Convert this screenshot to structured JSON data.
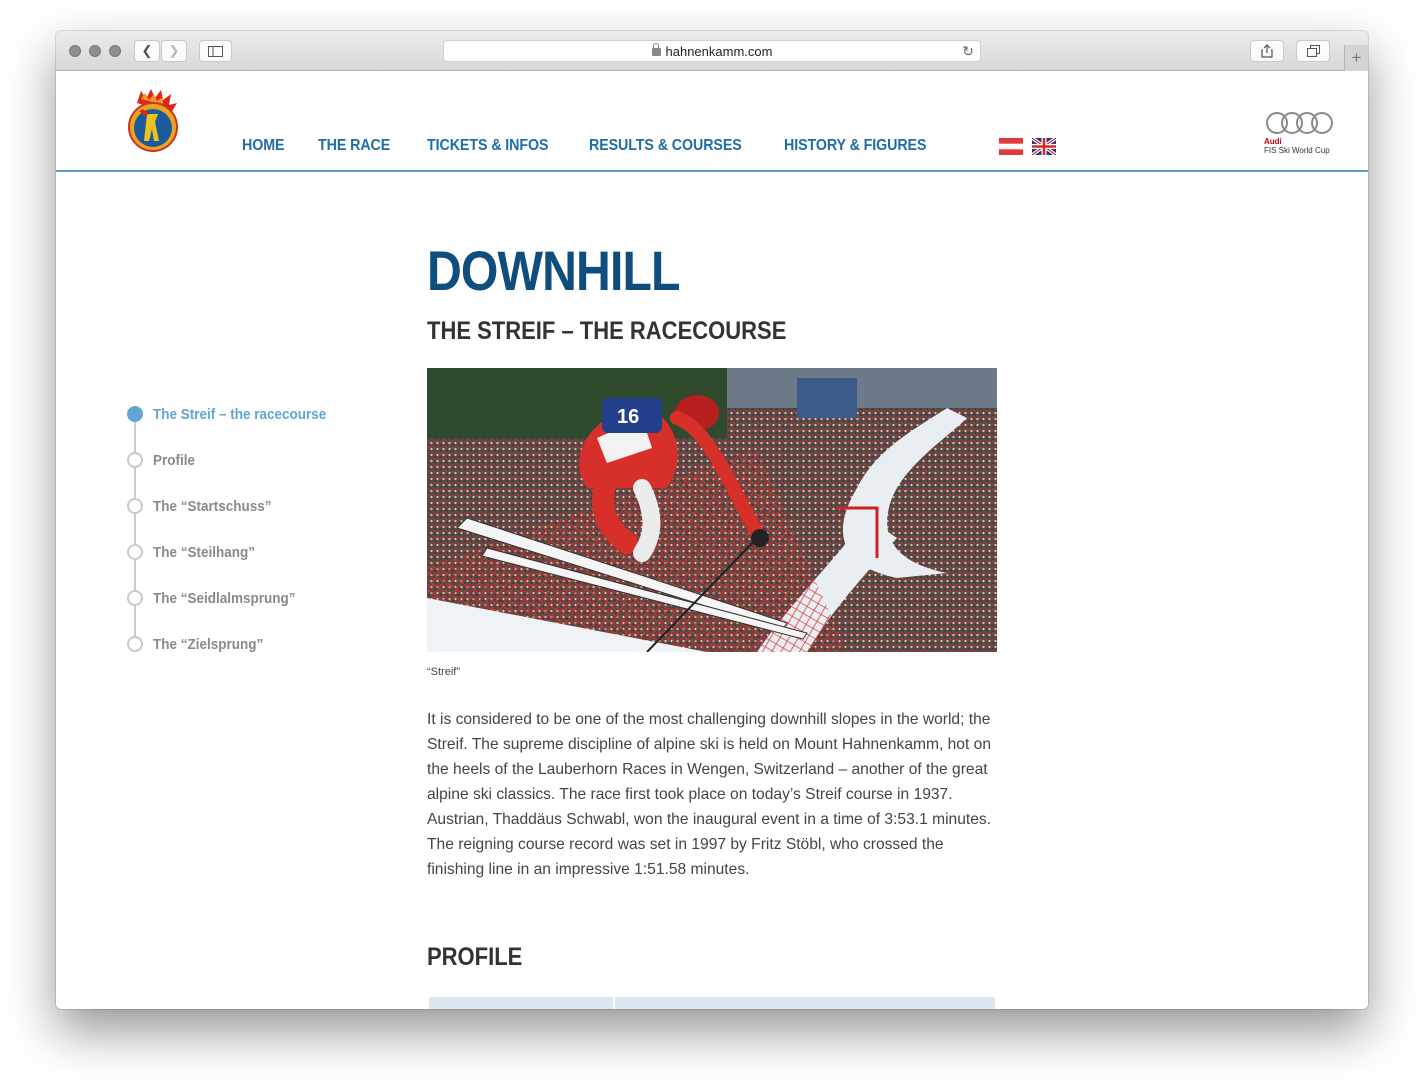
{
  "browser": {
    "url": "hahnenkamm.com"
  },
  "header": {
    "nav": [
      "HOME",
      "THE RACE",
      "TICKETS & INFOS",
      "RESULTS & COURSES",
      "HISTORY & FIGURES"
    ],
    "sponsor": {
      "line1": "Audi",
      "line2": "FIS Ski World Cup"
    }
  },
  "sidebar": {
    "items": [
      {
        "label": "The Streif – the racecourse",
        "active": true
      },
      {
        "label": "Profile",
        "active": false
      },
      {
        "label": "The “Startschuss”",
        "active": false
      },
      {
        "label": "The “Steilhang”",
        "active": false
      },
      {
        "label": "The “Seidlalmsprung”",
        "active": false
      },
      {
        "label": "The “Zielsprung”",
        "active": false
      }
    ]
  },
  "main": {
    "title": "DOWNHILL",
    "section_title": "THE STREIF – THE RACECOURSE",
    "image_caption": "“Streif”",
    "paragraph": "It is considered to be one of the most challenging downhill slopes in the world; the Streif. The supreme discipline of alpine ski is held on Mount Hahnenkamm, hot on the heels of the Lauberhorn Races in Wengen, Switzerland – another of the great alpine ski classics. The race first took place on today’s Streif course in 1937. Austrian, Thaddäus Schwabl, won the inaugural event in a time of 3:53.1 minutes. The reigning course record was set in 1997 by Fritz Stöbl, who crossed the finishing line in an impressive 1:51.58 minutes.",
    "profile_title": "PROFILE",
    "bib_number": "16"
  },
  "colors": {
    "nav": "#1f6da8",
    "title": "#0f4d7c",
    "accent": "#5ea7d5",
    "header_rule": "#5fa2c9"
  }
}
